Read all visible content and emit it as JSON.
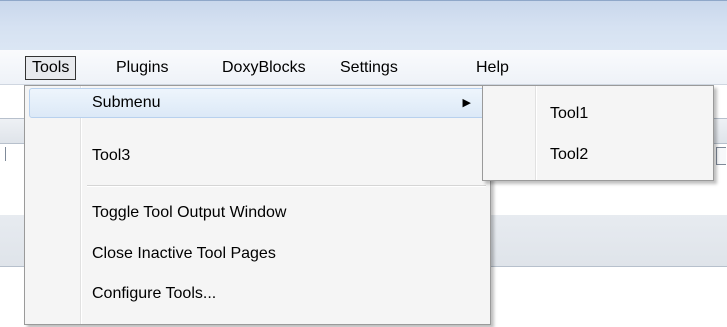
{
  "menubar": {
    "items": [
      {
        "label": "Tools",
        "active": true
      },
      {
        "label": "Plugins",
        "active": false
      },
      {
        "label": "DoxyBlocks",
        "active": false
      },
      {
        "label": "Settings",
        "active": false
      },
      {
        "label": "Help",
        "active": false
      }
    ]
  },
  "tools_menu": {
    "items": [
      {
        "label": "Submenu",
        "has_submenu": true,
        "highlighted": true
      },
      {
        "label": "Tool3",
        "has_submenu": false,
        "highlighted": false
      },
      {
        "label": "Toggle Tool Output Window",
        "has_submenu": false,
        "highlighted": false
      },
      {
        "label": "Close Inactive Tool Pages",
        "has_submenu": false,
        "highlighted": false
      },
      {
        "label": "Configure Tools...",
        "has_submenu": false,
        "highlighted": false
      }
    ],
    "submenu_arrow_icon": "triangle-right-icon"
  },
  "submenu": {
    "items": [
      {
        "label": "Tool1"
      },
      {
        "label": "Tool2"
      }
    ]
  },
  "colors": {
    "titlebar": "#d6e2f2",
    "menu_background": "#f5f5f5",
    "highlight": "#dce9f7",
    "highlight_border": "#b8d1ee"
  }
}
